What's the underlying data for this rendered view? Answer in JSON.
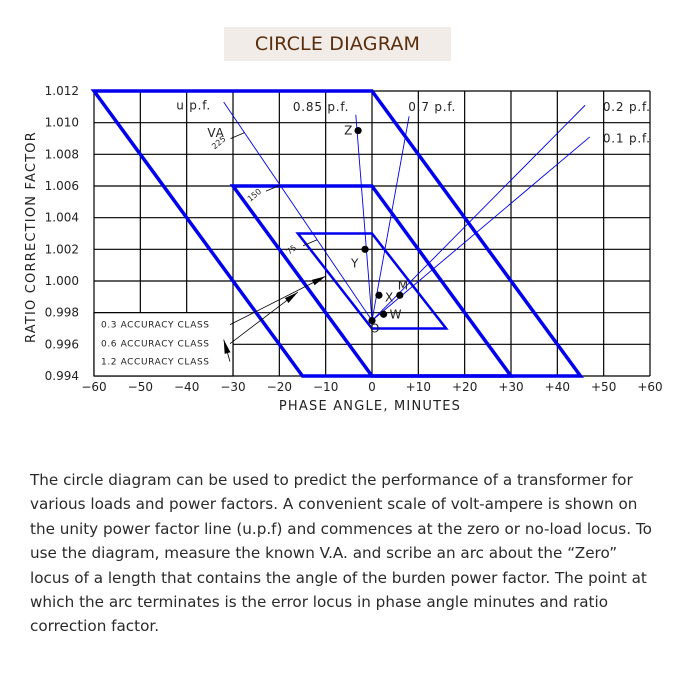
{
  "title": "CIRCLE DIAGRAM",
  "description": "The circle diagram can be used to predict the performance of a transformer for various loads and power factors.  A convenient scale of volt-ampere is shown on the unity power factor line (u.p.f) and commences at the zero or no-load locus. To use the diagram, measure the known V.A. and scribe an arc about the “Zero” locus of a length that contains the angle of the burden power factor. The point at which the arc terminates is the error locus in phase angle minutes and ratio correction factor.",
  "colors": {
    "accent": "#0000ee",
    "grid": "#000000",
    "title_text": "#5a2d0c",
    "title_bg": "#f1ece8"
  },
  "chart_data": {
    "type": "scatter",
    "title": "CIRCLE DIAGRAM",
    "xlabel": "PHASE ANGLE, MINUTES",
    "ylabel": "RATIO CORRECTION FACTOR",
    "xlim": [
      -60,
      60
    ],
    "ylim": [
      0.994,
      1.012
    ],
    "grid": true,
    "x_ticks": [
      -60,
      -50,
      -40,
      -30,
      -20,
      -10,
      0,
      10,
      20,
      30,
      40,
      50,
      60
    ],
    "x_tick_labels": [
      "−60",
      "−50",
      "−40",
      "−30",
      "−20",
      "−10",
      "0",
      "+10",
      "+20",
      "+30",
      "+40",
      "+50",
      "+60"
    ],
    "y_ticks": [
      1.012,
      1.01,
      1.008,
      1.006,
      1.004,
      1.002,
      1.0,
      0.998,
      0.996,
      0.994
    ],
    "y_tick_labels": [
      "1.012",
      "1.010",
      "1.008",
      "1.006",
      "1.004",
      "1.002",
      "1.000",
      "0.998",
      "0.996",
      "0.994"
    ],
    "accuracy_classes": [
      {
        "name": "0.3 ACCURACY CLASS",
        "polygon": [
          [
            -16,
            1.003
          ],
          [
            0,
            1.003
          ],
          [
            16,
            0.997
          ],
          [
            0,
            0.997
          ]
        ]
      },
      {
        "name": "0.6 ACCURACY CLASS",
        "polygon": [
          [
            -30,
            1.006
          ],
          [
            0,
            1.006
          ],
          [
            30,
            0.994
          ],
          [
            0,
            0.994
          ]
        ]
      },
      {
        "name": "1.2 ACCURACY CLASS",
        "polygon": [
          [
            -60,
            1.012
          ],
          [
            0,
            1.012
          ],
          [
            45,
            0.994
          ],
          [
            -15,
            0.994
          ]
        ]
      }
    ],
    "points": [
      {
        "label": "O",
        "x": 0,
        "y": 0.9975
      },
      {
        "label": "W",
        "x": 2.5,
        "y": 0.9979
      },
      {
        "label": "X",
        "x": 1.5,
        "y": 0.9991
      },
      {
        "label": "M",
        "x": 6,
        "y": 0.9991
      },
      {
        "label": "Y",
        "x": -1.5,
        "y": 1.002
      },
      {
        "label": "Z",
        "x": -3,
        "y": 1.0095
      }
    ],
    "pf_lines": [
      {
        "label": "u.p.f.",
        "to": [
          -32,
          1.0113
        ]
      },
      {
        "label": "0.85 p.f.",
        "to": [
          -3.5,
          1.0105
        ]
      },
      {
        "label": "0.7 p.f.",
        "to": [
          8,
          1.0104
        ]
      },
      {
        "label": "0.2 p.f.",
        "to": [
          46,
          1.0111
        ]
      },
      {
        "label": "0.1 p.f.",
        "to": [
          47,
          1.0091
        ]
      }
    ],
    "va_scale": {
      "label": "VA",
      "marks": [
        "75",
        "150",
        "225"
      ]
    },
    "annotations": [
      "u.p.f.",
      "0.85 p.f.",
      "0.7 p.f.",
      "0.2 p.f.",
      "0.1 p.f.",
      "VA"
    ]
  }
}
